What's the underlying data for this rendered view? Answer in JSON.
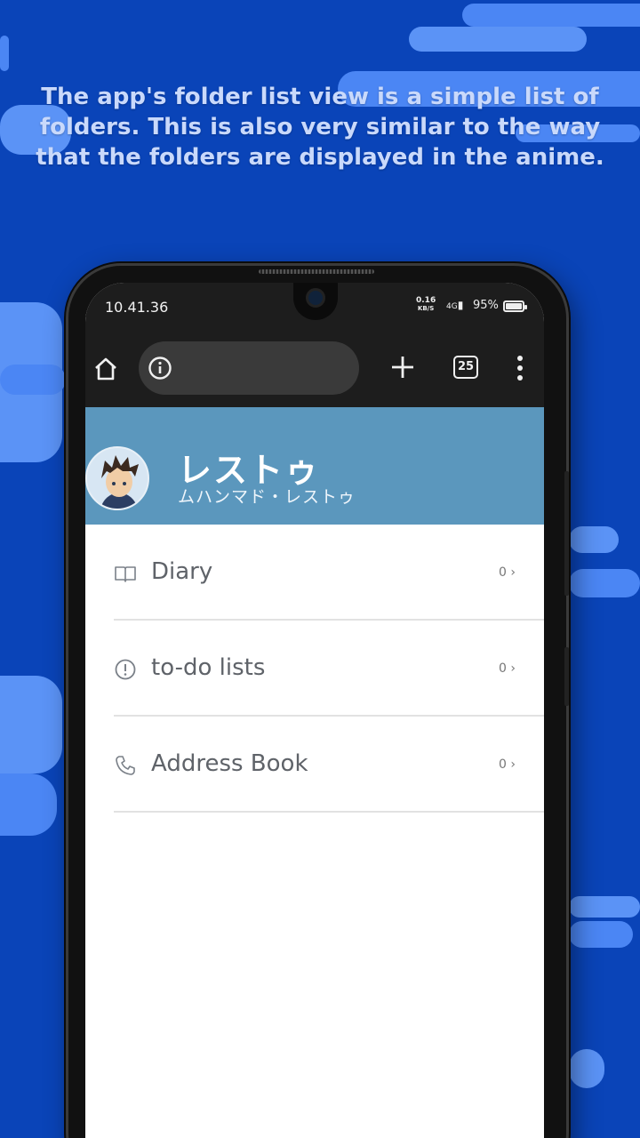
{
  "caption": "The app's folder list view is a simple list of folders. This is also very similar to the way that the folders are displayed in the anime.",
  "status_bar": {
    "time": "10.41.36",
    "net_speed_value": "0.16",
    "net_speed_unit": "KB/S",
    "signal": "4G",
    "battery": "95%",
    "battery_level": 0.95
  },
  "browser": {
    "tab_count": "25",
    "icons": [
      "home-icon",
      "info-icon",
      "plus-icon",
      "tabs-icon",
      "more-vert-icon"
    ]
  },
  "header": {
    "title": "レストゥ",
    "subtitle": "ムハンマド・レストゥ",
    "background": "#5b97bd"
  },
  "folders": [
    {
      "label": "Diary",
      "count": "0",
      "icon": "book-icon"
    },
    {
      "label": "to-do lists",
      "count": "0",
      "icon": "alert-circle-icon"
    },
    {
      "label": "Address Book",
      "count": "0",
      "icon": "phone-icon"
    }
  ],
  "colors": {
    "background": "#0a44b8",
    "accent": "#4b86f4"
  }
}
